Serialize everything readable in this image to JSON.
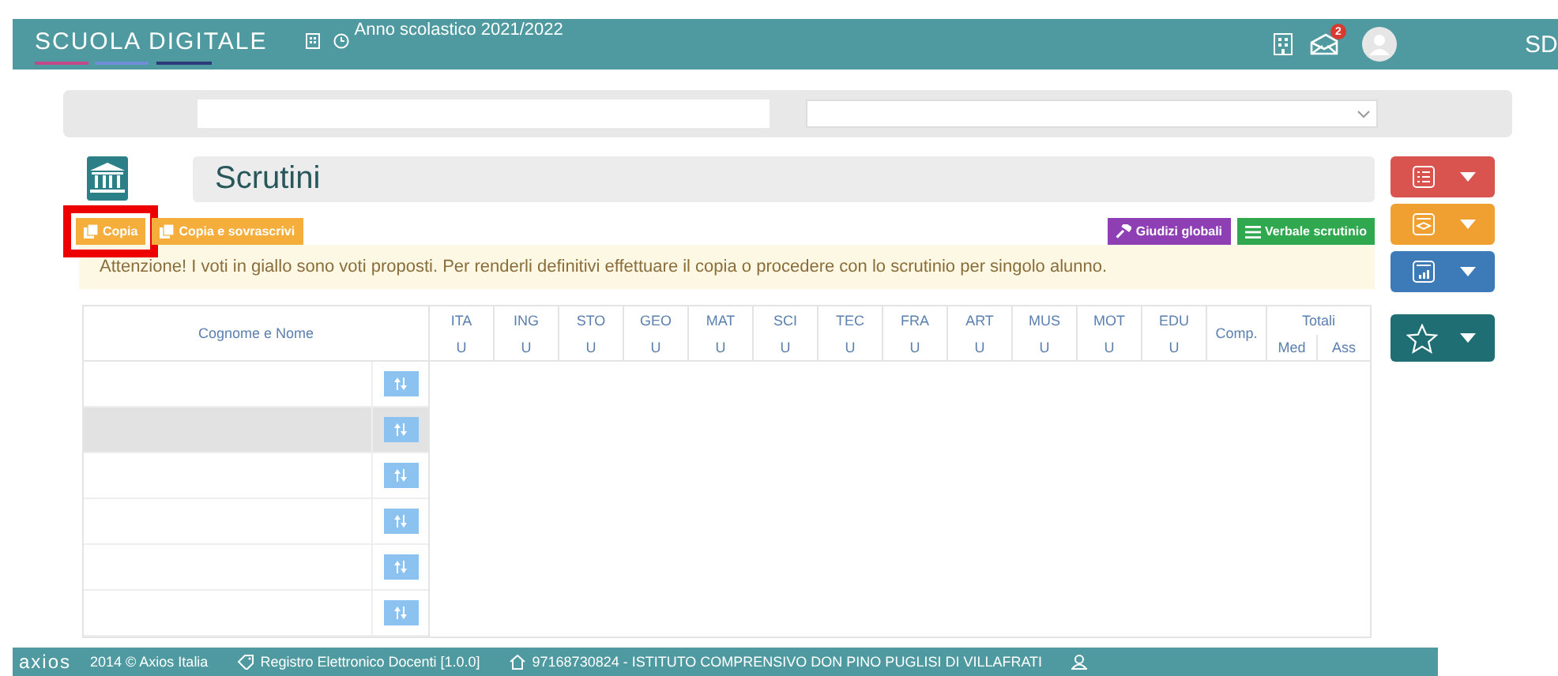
{
  "header": {
    "logo": "SCUOLA DIGITALE",
    "school_year": "Anno scolastico 2021/2022",
    "messages_badge": "2",
    "corner_logo": "SD"
  },
  "page": {
    "title": "Scrutini"
  },
  "actions": [
    {
      "label": "Copia",
      "highlighted": true,
      "kind": "copy"
    },
    {
      "label": "Copia e sovrascrivi",
      "highlighted": false,
      "kind": "copy"
    },
    {
      "label": "Giudizi globali",
      "highlighted": false,
      "kind": "gavel"
    },
    {
      "label": "Verbale scrutinio",
      "highlighted": false,
      "kind": "list"
    }
  ],
  "alert": "Attenzione! I voti in giallo sono voti proposti. Per renderli definitivi effettuare il copia o procedere con lo scrutinio per singolo alunno.",
  "table": {
    "name_column": "Cognome e Nome",
    "subjects": [
      {
        "code": "ITA",
        "type": "U"
      },
      {
        "code": "ING",
        "type": "U"
      },
      {
        "code": "STO",
        "type": "U"
      },
      {
        "code": "GEO",
        "type": "U"
      },
      {
        "code": "MAT",
        "type": "U"
      },
      {
        "code": "SCI",
        "type": "U"
      },
      {
        "code": "TEC",
        "type": "U"
      },
      {
        "code": "FRA",
        "type": "U"
      },
      {
        "code": "ART",
        "type": "U"
      },
      {
        "code": "MUS",
        "type": "U"
      },
      {
        "code": "MOT",
        "type": "U"
      },
      {
        "code": "EDU",
        "type": "U"
      }
    ],
    "comp_column": "Comp.",
    "totals": {
      "label": "Totali",
      "columns": [
        "Med",
        "Ass"
      ]
    },
    "rows": [
      {
        "hovered": false
      },
      {
        "hovered": true
      },
      {
        "hovered": false
      },
      {
        "hovered": false
      },
      {
        "hovered": false
      },
      {
        "hovered": false
      }
    ]
  },
  "side_menu": [
    {
      "kind": "list",
      "color": "#d9534f"
    },
    {
      "kind": "diploma",
      "color": "#f0a030"
    },
    {
      "kind": "chart",
      "color": "#3d7ab8"
    },
    {
      "kind": "star",
      "color": "#1e6e73"
    }
  ],
  "footer": {
    "brand": "axios",
    "copyright": "2014 © Axios Italia",
    "product": "Registro Elettronico Docenti [1.0.0]",
    "school": "97168730824 - ISTITUTO COMPRENSIVO DON PINO PUGLISI DI VILLAFRATI"
  }
}
